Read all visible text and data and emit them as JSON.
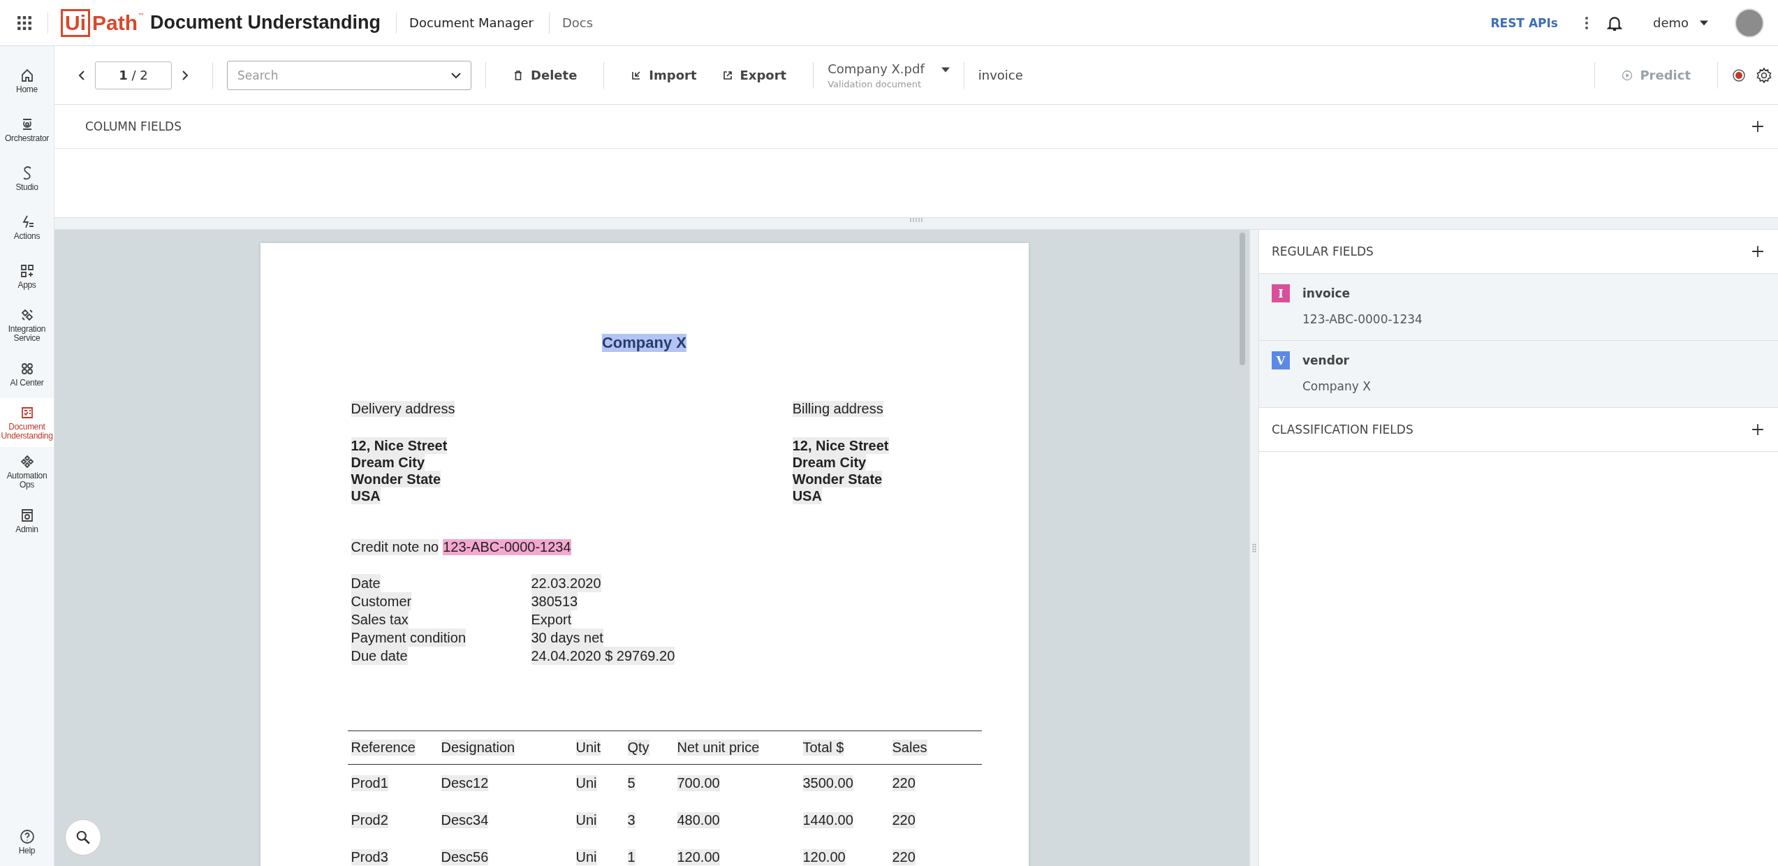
{
  "topbar": {
    "brand_mark": "Ui",
    "brand_name": "Path",
    "trademark": "™",
    "product": "Document Understanding",
    "nav": [
      "Document Manager",
      "Docs"
    ],
    "link": "REST APIs",
    "user": "demo"
  },
  "sidebar": {
    "items": [
      {
        "label": "Home",
        "selected": false
      },
      {
        "label": "Orchestrator",
        "selected": false
      },
      {
        "label": "Studio",
        "selected": false
      },
      {
        "label": "Actions",
        "selected": false
      },
      {
        "label": "Apps",
        "selected": false
      },
      {
        "label": "Integration Service",
        "selected": false
      },
      {
        "label": "AI Center",
        "selected": false
      },
      {
        "label": "Document Understanding",
        "selected": true
      },
      {
        "label": "Automation Ops",
        "selected": false
      },
      {
        "label": "Admin",
        "selected": false
      }
    ],
    "help": "Help"
  },
  "toolbar": {
    "page": "**1** / 2",
    "search": {
      "placeholder": "Search"
    },
    "buttons": [
      {
        "label": "Delete"
      },
      {
        "label": "Import"
      },
      {
        "label": "Export"
      }
    ],
    "document": {
      "name": "Company X.pdf",
      "subtitle": "Validation document"
    },
    "document_type": "invoice",
    "predict": {
      "label": "Predict",
      "disabled": true
    }
  },
  "column_fields": {
    "title": "COLUMN FIELDS"
  },
  "document": {
    "title": {
      "text": "Company X",
      "color": "#b3c4f4"
    },
    "addresses": [
      {
        "heading": "Delivery address",
        "lines": [
          "12, Nice Street",
          "Dream City",
          "Wonder State",
          "USA"
        ]
      },
      {
        "heading": "Billing address",
        "lines": [
          "12, Nice Street",
          "Dream City",
          "Wonder State",
          "USA"
        ]
      }
    ],
    "credit_note": {
      "label": "Credit note no",
      "value": "123-ABC-0000-1234",
      "color": "#f4a8cf"
    },
    "details": [
      {
        "label": "Date",
        "value": "22.03.2020"
      },
      {
        "label": "Customer",
        "value": "380513"
      },
      {
        "label": "Sales tax",
        "value": "Export"
      },
      {
        "label": "Payment condition",
        "value": "30 days net"
      },
      {
        "label": "Due date",
        "value": "24.04.2020 $ 29769.20"
      }
    ],
    "table": {
      "columns": [
        "Reference",
        "Designation",
        "Unit",
        "Qty",
        "Net unit price",
        "Total $",
        "Sales"
      ],
      "rows": [
        [
          "Prod1",
          "Desc12",
          "Uni",
          "5",
          "700.00",
          "3500.00",
          "220"
        ],
        [
          "Prod2",
          "Desc34",
          "Uni",
          "3",
          "480.00",
          "1440.00",
          "220"
        ],
        [
          "Prod3",
          "Desc56",
          "Uni",
          "1",
          "120.00",
          "120.00",
          "220"
        ]
      ]
    }
  },
  "fields_panel": {
    "sections": [
      {
        "title": "REGULAR FIELDS",
        "fields": [
          {
            "badge": "I",
            "name": "invoice",
            "value": "123-ABC-0000-1234",
            "color": "#d9509a"
          },
          {
            "badge": "V",
            "name": "vendor",
            "value": "Company X",
            "color": "#5b8ae6"
          }
        ]
      },
      {
        "title": "CLASSIFICATION FIELDS"
      }
    ]
  }
}
